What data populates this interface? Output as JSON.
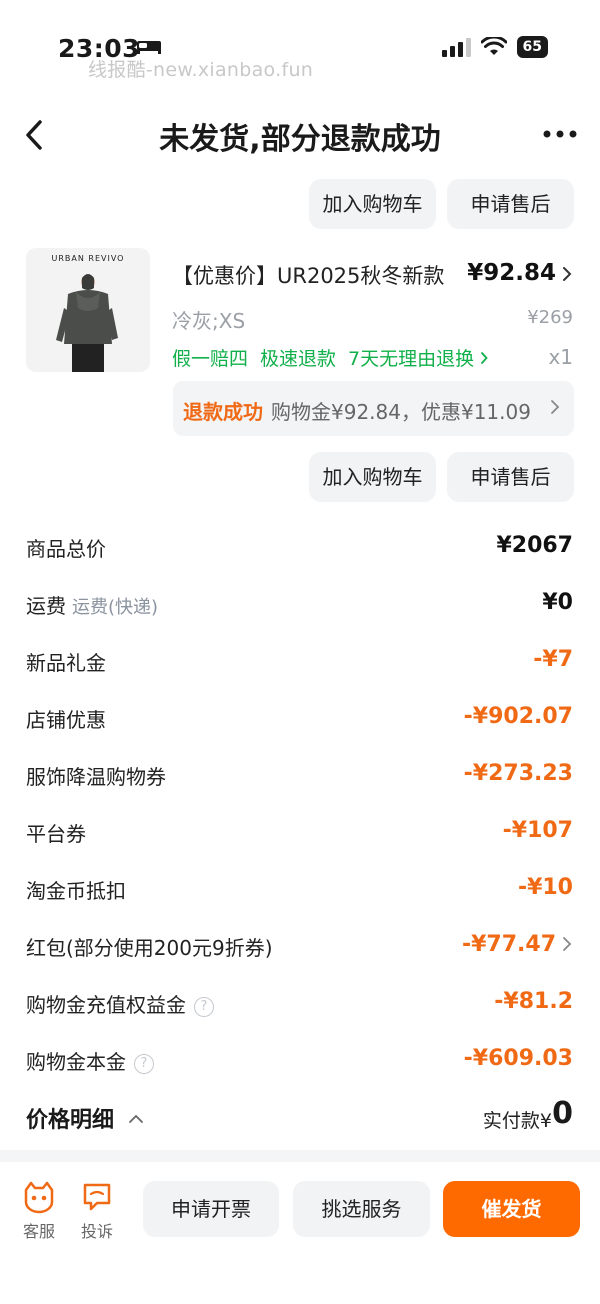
{
  "status_bar": {
    "time": "23:03",
    "battery": "65"
  },
  "watermark": "线报酷-new.xianbao.fun",
  "header": {
    "title": "未发货,部分退款成功"
  },
  "top_actions": {
    "add_cart": "加入购物车",
    "after_sale": "申请售后"
  },
  "product": {
    "brand": "URBAN REVIVO",
    "name": "【优惠价】UR2025秋冬新款",
    "price": "¥92.84",
    "spec": "冷灰;XS",
    "original_price": "¥269",
    "tags": [
      "假一赔四",
      "极速退款",
      "7天无理由退换"
    ],
    "qty": "x1",
    "refund_status": "退款成功",
    "refund_detail": "购物金¥92.84，优惠¥11.09"
  },
  "item_actions": {
    "add_cart": "加入购物车",
    "after_sale": "申请售后"
  },
  "price_rows": [
    {
      "label": "商品总价",
      "value": "¥2067"
    },
    {
      "label": "运费",
      "sub": "运费(快递)",
      "value": "¥0"
    },
    {
      "label": "新品礼金",
      "value": "-¥7"
    },
    {
      "label": "店铺优惠",
      "value": "-¥902.07"
    },
    {
      "label": "服饰降温购物券",
      "value": "-¥273.23"
    },
    {
      "label": "平台券",
      "value": "-¥107"
    },
    {
      "label": "淘金币抵扣",
      "value": "-¥10"
    },
    {
      "label": "红包(部分使用200元9折券)",
      "value": "-¥77.47"
    },
    {
      "label": "购物金充值权益金",
      "value": "-¥81.2"
    },
    {
      "label": "购物金本金",
      "value": "-¥609.03"
    }
  ],
  "summary": {
    "detail_label": "价格明细",
    "paid_label": "实付款¥",
    "paid_value": "0"
  },
  "bottom_bar": {
    "service": "客服",
    "complaint": "投诉",
    "invoice": "申请开票",
    "pick_service": "挑选服务",
    "urge": "催发货"
  },
  "colors": {
    "accent": "#f06a16",
    "green": "#12b04a",
    "primary_button": "#ff6a00"
  }
}
